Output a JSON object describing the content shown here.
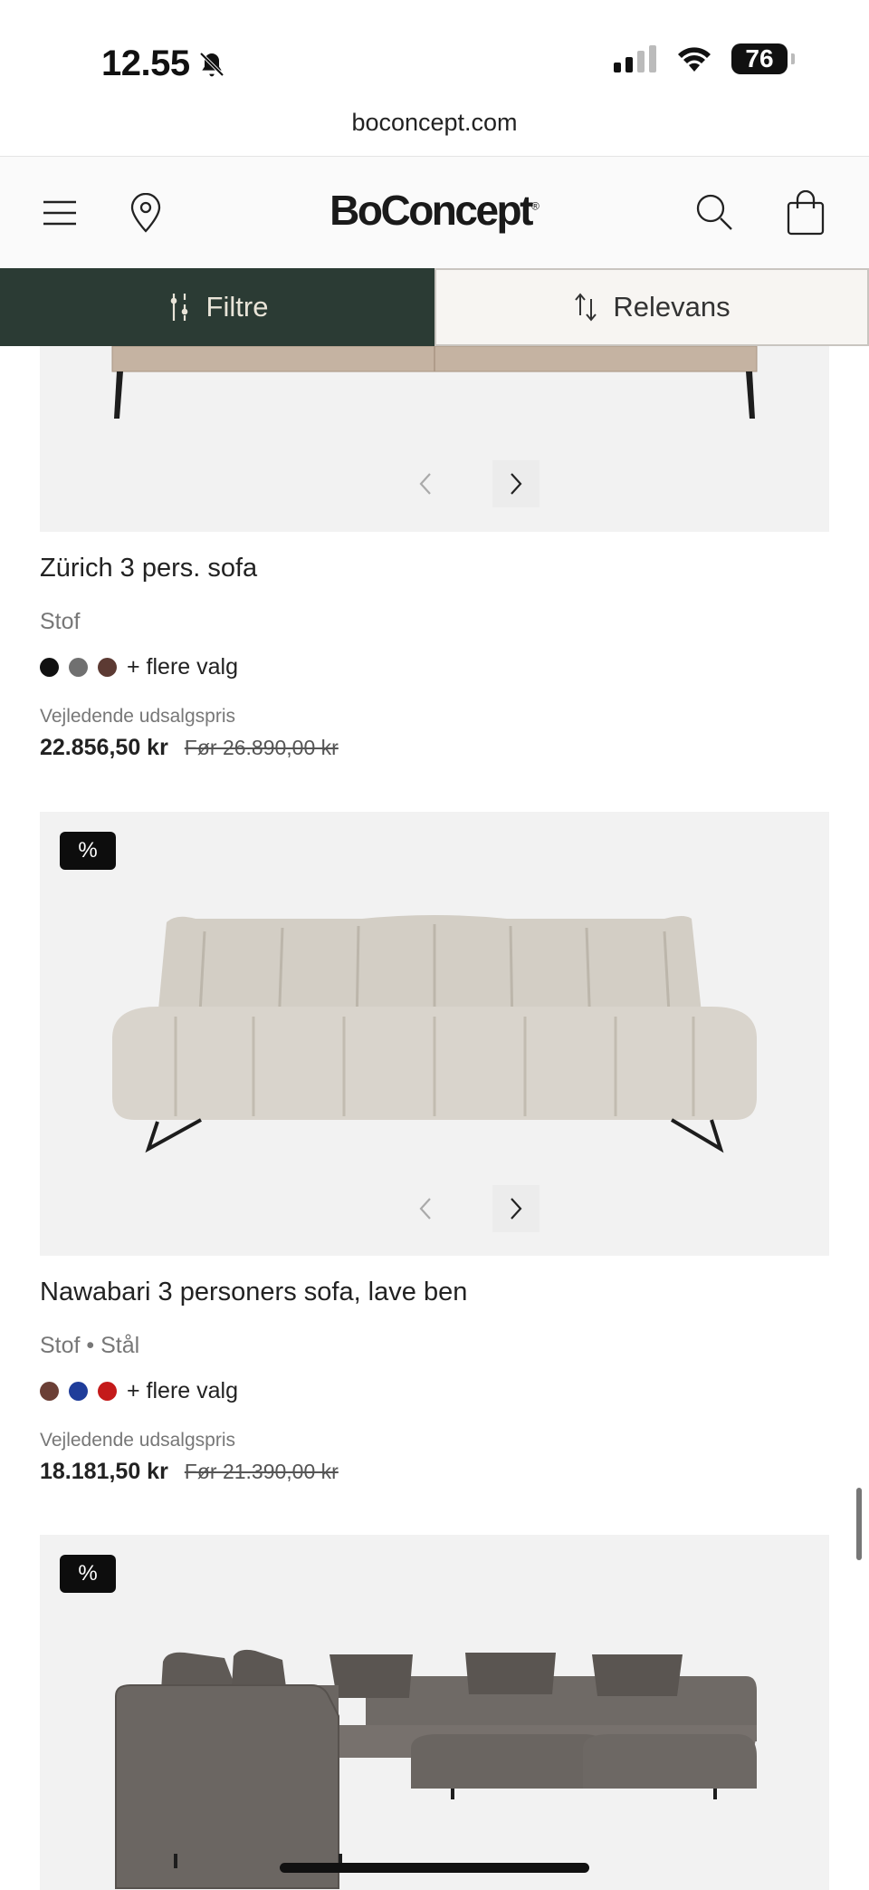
{
  "status": {
    "time": "12.55",
    "battery": "76"
  },
  "browser": {
    "url": "boconcept.com"
  },
  "header": {
    "logo": "BoConcept",
    "logo_mark": "®"
  },
  "toolbar": {
    "filter_label": "Filtre",
    "sort_label": "Relevans"
  },
  "products": [
    {
      "name": "Zürich 3 pers. sofa",
      "material": "Stof",
      "swatches": [
        "#111111",
        "#707070",
        "#5c3a33"
      ],
      "more_label": "+ flere valg",
      "price_label": "Vejledende udsalgspris",
      "price": "22.856,50 kr",
      "price_before": "Før 26.890,00 kr"
    },
    {
      "badge": "%",
      "name": "Nawabari 3 personers sofa, lave ben",
      "material": "Stof • Stål",
      "swatches": [
        "#6b3f36",
        "#1f3d9a",
        "#c41a1a"
      ],
      "more_label": "+ flere valg",
      "price_label": "Vejledende udsalgspris",
      "price": "18.181,50 kr",
      "price_before": "Før 21.390,00 kr"
    },
    {
      "badge": "%"
    }
  ],
  "colors": {
    "filter_bg": "#2b3b34",
    "image_bg": "#f2f2f2"
  }
}
